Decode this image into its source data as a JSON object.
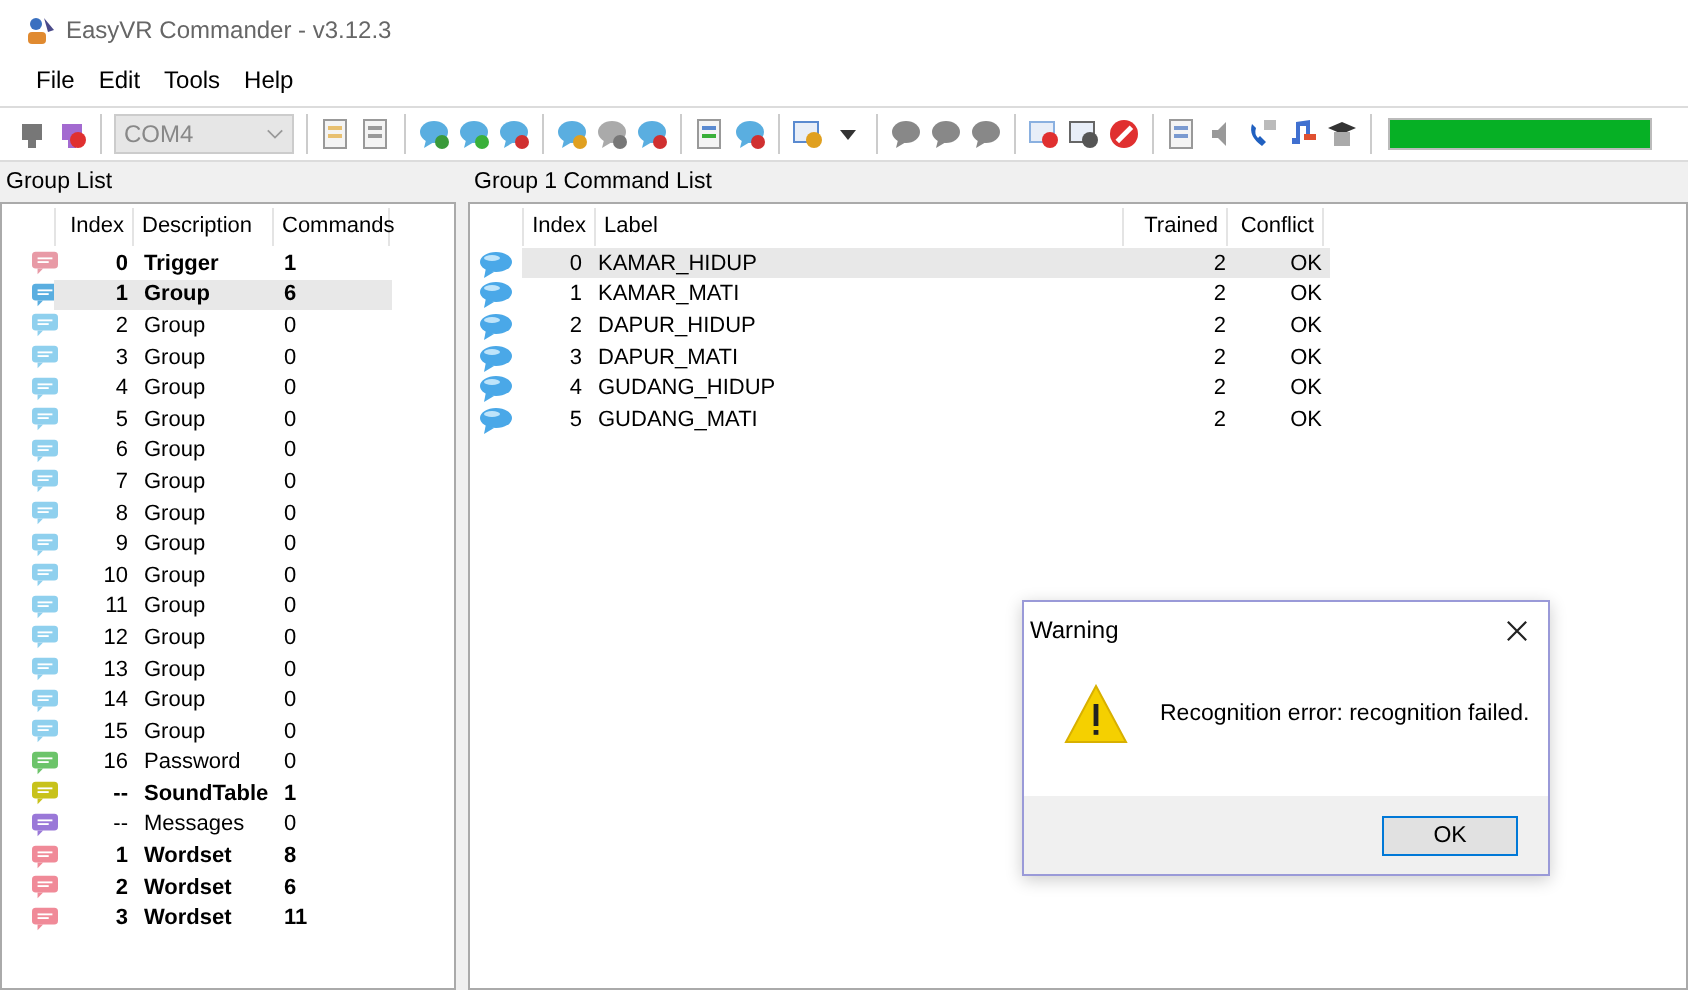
{
  "window": {
    "title": "EasyVR Commander - v3.12.3"
  },
  "menu": [
    "File",
    "Edit",
    "Tools",
    "Help"
  ],
  "toolbar": {
    "port": {
      "value": "COM4",
      "disabled": true
    },
    "meter": {
      "level": 1
    }
  },
  "group_panel": {
    "title": "Group List",
    "columns": [
      "Index",
      "Description",
      "Commands"
    ],
    "rows": [
      {
        "index": "0",
        "description": "Trigger",
        "commands": "1",
        "bold": true,
        "selected": false,
        "color": "#e89aa6"
      },
      {
        "index": "1",
        "description": "Group",
        "commands": "6",
        "bold": true,
        "selected": true,
        "color": "#5aaee0"
      },
      {
        "index": "2",
        "description": "Group",
        "commands": "0",
        "bold": false,
        "selected": false,
        "color": "#8fd0ee"
      },
      {
        "index": "3",
        "description": "Group",
        "commands": "0",
        "bold": false,
        "selected": false,
        "color": "#8fd0ee"
      },
      {
        "index": "4",
        "description": "Group",
        "commands": "0",
        "bold": false,
        "selected": false,
        "color": "#8fd0ee"
      },
      {
        "index": "5",
        "description": "Group",
        "commands": "0",
        "bold": false,
        "selected": false,
        "color": "#8fd0ee"
      },
      {
        "index": "6",
        "description": "Group",
        "commands": "0",
        "bold": false,
        "selected": false,
        "color": "#8fd0ee"
      },
      {
        "index": "7",
        "description": "Group",
        "commands": "0",
        "bold": false,
        "selected": false,
        "color": "#8fd0ee"
      },
      {
        "index": "8",
        "description": "Group",
        "commands": "0",
        "bold": false,
        "selected": false,
        "color": "#8fd0ee"
      },
      {
        "index": "9",
        "description": "Group",
        "commands": "0",
        "bold": false,
        "selected": false,
        "color": "#8fd0ee"
      },
      {
        "index": "10",
        "description": "Group",
        "commands": "0",
        "bold": false,
        "selected": false,
        "color": "#8fd0ee"
      },
      {
        "index": "11",
        "description": "Group",
        "commands": "0",
        "bold": false,
        "selected": false,
        "color": "#8fd0ee"
      },
      {
        "index": "12",
        "description": "Group",
        "commands": "0",
        "bold": false,
        "selected": false,
        "color": "#8fd0ee"
      },
      {
        "index": "13",
        "description": "Group",
        "commands": "0",
        "bold": false,
        "selected": false,
        "color": "#8fd0ee"
      },
      {
        "index": "14",
        "description": "Group",
        "commands": "0",
        "bold": false,
        "selected": false,
        "color": "#8fd0ee"
      },
      {
        "index": "15",
        "description": "Group",
        "commands": "0",
        "bold": false,
        "selected": false,
        "color": "#8fd0ee"
      },
      {
        "index": "16",
        "description": "Password",
        "commands": "0",
        "bold": false,
        "selected": false,
        "color": "#6cc46a"
      },
      {
        "index": "--",
        "description": "SoundTable",
        "commands": "1",
        "bold": true,
        "selected": false,
        "color": "#c8c21a"
      },
      {
        "index": "--",
        "description": "Messages",
        "commands": "0",
        "bold": false,
        "selected": false,
        "color": "#9a78d8"
      },
      {
        "index": "1",
        "description": "Wordset",
        "commands": "8",
        "bold": true,
        "selected": false,
        "color": "#f08a98"
      },
      {
        "index": "2",
        "description": "Wordset",
        "commands": "6",
        "bold": true,
        "selected": false,
        "color": "#f08a98"
      },
      {
        "index": "3",
        "description": "Wordset",
        "commands": "11",
        "bold": true,
        "selected": false,
        "color": "#f08a98"
      }
    ]
  },
  "command_panel": {
    "title": "Group 1 Command List",
    "columns": [
      "Index",
      "Label",
      "Trained",
      "Conflict"
    ],
    "rows": [
      {
        "index": "0",
        "label": "KAMAR_HIDUP",
        "trained": "2",
        "conflict": "OK",
        "selected": true
      },
      {
        "index": "1",
        "label": "KAMAR_MATI",
        "trained": "2",
        "conflict": "OK",
        "selected": false
      },
      {
        "index": "2",
        "label": "DAPUR_HIDUP",
        "trained": "2",
        "conflict": "OK",
        "selected": false
      },
      {
        "index": "3",
        "label": "DAPUR_MATI",
        "trained": "2",
        "conflict": "OK",
        "selected": false
      },
      {
        "index": "4",
        "label": "GUDANG_HIDUP",
        "trained": "2",
        "conflict": "OK",
        "selected": false
      },
      {
        "index": "5",
        "label": "GUDANG_MATI",
        "trained": "2",
        "conflict": "OK",
        "selected": false
      }
    ]
  },
  "dialog": {
    "title": "Warning",
    "message": "Recognition error: recognition failed.",
    "buttons": [
      "OK"
    ]
  }
}
